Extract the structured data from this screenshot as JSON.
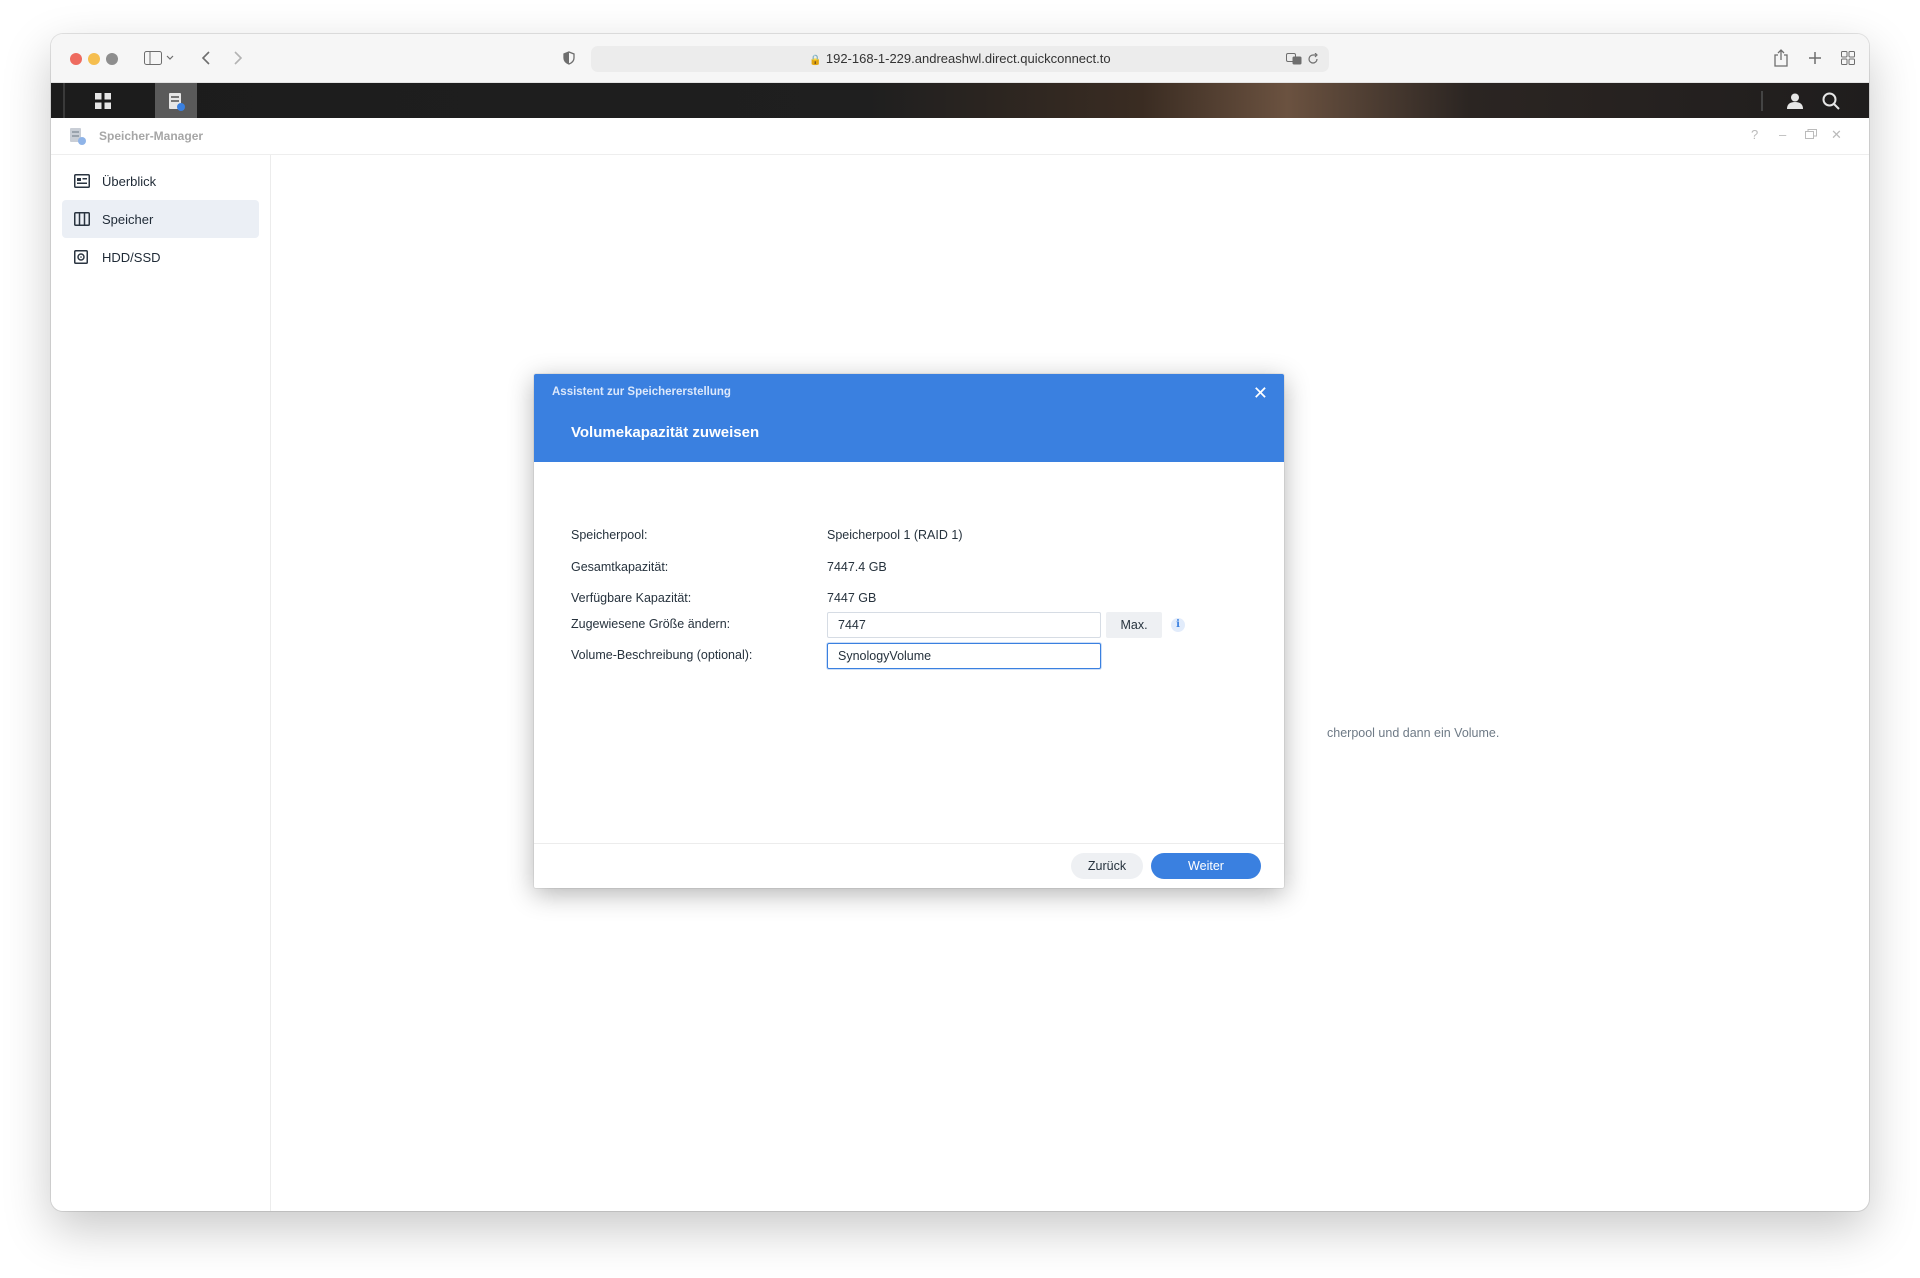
{
  "browser": {
    "url": "192-168-1-229.andreashwl.direct.quickconnect.to"
  },
  "app": {
    "title": "Speicher-Manager",
    "help_glyph": "?",
    "minimize_glyph": "–",
    "close_glyph": "✕"
  },
  "sidebar": {
    "items": [
      {
        "label": "Überblick",
        "icon": "overview-icon",
        "active": false
      },
      {
        "label": "Speicher",
        "icon": "storage-icon",
        "active": true
      },
      {
        "label": "HDD/SSD",
        "icon": "disk-icon",
        "active": false
      }
    ]
  },
  "background": {
    "message_fragment": "cherpool und dann ein Volume."
  },
  "dialog": {
    "wizard_title": "Assistent zur Speichererstellung",
    "step_title": "Volumekapazität zuweisen",
    "close_glyph": "✕",
    "fields": {
      "pool_label": "Speicherpool:",
      "pool_value": "Speicherpool 1 (RAID 1)",
      "total_label": "Gesamtkapazität:",
      "total_value": "7447.4 GB",
      "available_label": "Verfügbare Kapazität:",
      "available_value": "7447 GB",
      "size_label": "Zugewiesene Größe ändern:",
      "size_value": "7447",
      "max_label": "Max.",
      "info_glyph": "i",
      "desc_label": "Volume-Beschreibung (optional):",
      "desc_value": "SynologyVolume"
    },
    "buttons": {
      "back": "Zurück",
      "next": "Weiter"
    }
  },
  "colors": {
    "accent": "#3a80e0",
    "sidebar_active": "#ebeff5"
  }
}
